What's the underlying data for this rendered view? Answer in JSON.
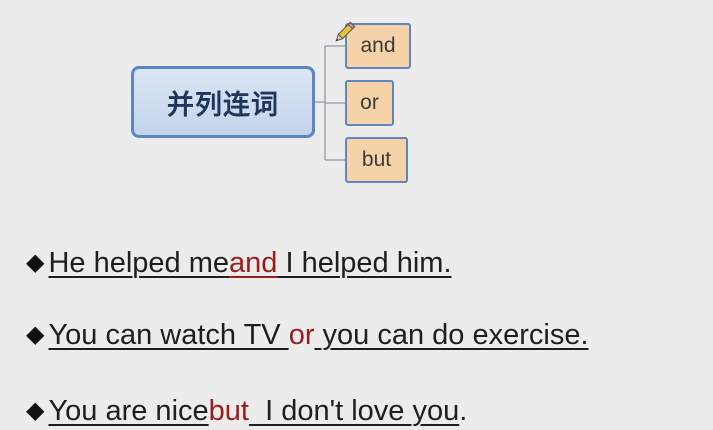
{
  "mindmap": {
    "root": "并列连词",
    "children": [
      "and",
      "or",
      "but"
    ]
  },
  "sentences": [
    {
      "bullet": "◆",
      "before": "He helped me",
      "conj": "and",
      "after": " I helped him.",
      "end": ""
    },
    {
      "bullet": "◆",
      "before": "You can watch TV ",
      "conj": "or",
      "after": " you can do exercise.",
      "end": ""
    },
    {
      "bullet": "◆",
      "before": "You are nice",
      "conj": "but",
      "after": "  I don't love you",
      "end": "."
    }
  ],
  "colors": {
    "conjunction": "#9e1a1a",
    "root_border": "#5b86c4",
    "child_fill": "#f6d2a9"
  }
}
